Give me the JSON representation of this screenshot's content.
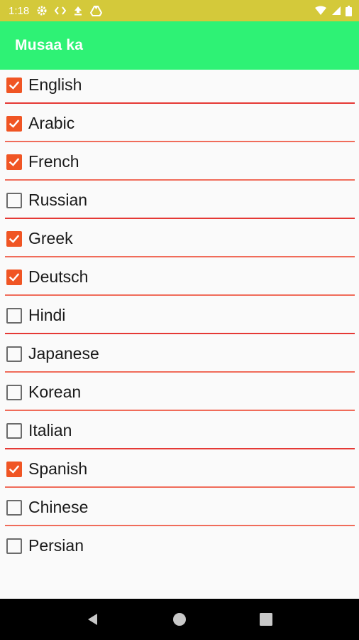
{
  "status_bar": {
    "time": "1:18",
    "left_icons": [
      "gear-icon",
      "code-icon",
      "upload-icon",
      "drive-icon"
    ],
    "right_icons": [
      "wifi-icon",
      "signal-icon",
      "battery-icon"
    ],
    "background": "#d4c93a"
  },
  "app_bar": {
    "title": "Musaa ka",
    "background": "#2ef275"
  },
  "languages": {
    "items": [
      {
        "label": "English",
        "checked": true,
        "divider": "#e53935"
      },
      {
        "label": "Arabic",
        "checked": true,
        "divider": "#f06c5a"
      },
      {
        "label": "French",
        "checked": true,
        "divider": "#f06c5a"
      },
      {
        "label": "Russian",
        "checked": false,
        "divider": "#e53935"
      },
      {
        "label": "Greek",
        "checked": true,
        "divider": "#f06c5a"
      },
      {
        "label": "Deutsch",
        "checked": true,
        "divider": "#f06c5a"
      },
      {
        "label": "Hindi",
        "checked": false,
        "divider": "#e53935"
      },
      {
        "label": "Japanese",
        "checked": false,
        "divider": "#f06c5a"
      },
      {
        "label": "Korean",
        "checked": false,
        "divider": "#f06c5a"
      },
      {
        "label": "Italian",
        "checked": false,
        "divider": "#e53935"
      },
      {
        "label": "Spanish",
        "checked": true,
        "divider": "#f06c5a"
      },
      {
        "label": "Chinese",
        "checked": false,
        "divider": "#f06c5a"
      },
      {
        "label": "Persian",
        "checked": false,
        "divider": ""
      }
    ],
    "checkbox_color": "#f05524"
  },
  "nav_bar": {
    "buttons": [
      "back-icon",
      "home-icon",
      "recents-icon"
    ]
  }
}
